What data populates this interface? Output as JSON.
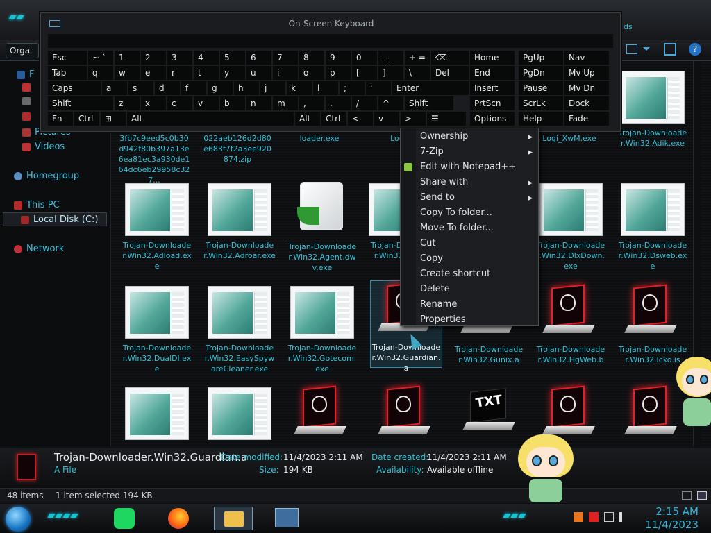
{
  "toolbar": {
    "organize": "Orga",
    "nav_fragment": "ds"
  },
  "keyboard": {
    "title": "On-Screen Keyboard",
    "row1": [
      "Esc",
      "~ `",
      "1",
      "2",
      "3",
      "4",
      "5",
      "6",
      "7",
      "8",
      "9",
      "0",
      "- _",
      "+ =",
      "⌫"
    ],
    "row1_sub": [
      "",
      "",
      "!",
      "@",
      "#",
      "$",
      "%",
      "^",
      "&",
      "*",
      "(",
      ")",
      "",
      ""
    ],
    "row2": [
      "Tab",
      "q",
      "w",
      "e",
      "r",
      "t",
      "y",
      "u",
      "i",
      "o",
      "p",
      "[",
      "]",
      "\\",
      "Del"
    ],
    "row3": [
      "Caps",
      "a",
      "s",
      "d",
      "f",
      "g",
      "h",
      "j",
      "k",
      "l",
      ";",
      "'",
      "Enter"
    ],
    "row4": [
      "Shift",
      "z",
      "x",
      "c",
      "v",
      "b",
      "n",
      "m",
      ",",
      ".",
      "/",
      "^",
      "Shift"
    ],
    "row5": [
      "Fn",
      "Ctrl",
      "⊞",
      "Alt",
      "Alt",
      "Ctrl",
      "<",
      "v",
      ">",
      "☰"
    ],
    "nav": [
      [
        "Home",
        "PgUp",
        "Nav"
      ],
      [
        "End",
        "PgDn",
        "Mv Up"
      ],
      [
        "Insert",
        "Pause",
        "Mv Dn"
      ],
      [
        "PrtScn",
        "ScrLk",
        "Dock"
      ],
      [
        "Options",
        "Help",
        "Fade"
      ]
    ]
  },
  "nav": {
    "items": [
      {
        "label": "F",
        "icon": "favorites-star-icon"
      },
      {
        "label": "Pictures",
        "icon": "pictures-icon"
      },
      {
        "label": "Videos",
        "icon": "videos-icon"
      },
      {
        "label": "Homegroup",
        "icon": "homegroup-icon"
      },
      {
        "label": "This PC",
        "icon": "computer-icon"
      },
      {
        "label": "Local Disk (C:)",
        "icon": "drive-icon"
      },
      {
        "label": "Network",
        "icon": "network-icon"
      }
    ]
  },
  "files": [
    {
      "name": "3fb7c9eed5c0b30d942f80b397a13e6ea81ec3a930de164dc6eb29958c327...",
      "kind": "partial"
    },
    {
      "name": "022aeb126d2d80e683f7f2a3ee920874.zip",
      "kind": "partial"
    },
    {
      "name": "loader.exe",
      "kind": "partial"
    },
    {
      "name": "Logi_X",
      "kind": "partial"
    },
    {
      "name": "Logi_XwM.exe",
      "kind": "partial"
    },
    {
      "name": "Trojan-Downloader.Win32.Adik.exe",
      "kind": "doc"
    },
    {
      "name": "Trojan-Downloader.Win32.Adload.exe",
      "kind": "doc"
    },
    {
      "name": "Trojan-Downloader.Win32.Adroar.exe",
      "kind": "doc"
    },
    {
      "name": "Trojan-Downloader.Win32.Agent.dwv.exe",
      "kind": "cube"
    },
    {
      "name": "Trojan-Downloader.Win32.Agent.h",
      "kind": "doc"
    },
    {
      "name": "Trojan-Downloader.Win32.DlxDown.exe",
      "kind": "doc"
    },
    {
      "name": "Trojan-Downloader.Win32.Dsweb.exe",
      "kind": "doc"
    },
    {
      "name": "Trojan-Downloader.Win32.DualDl.exe",
      "kind": "doc"
    },
    {
      "name": "Trojan-Downloader.Win32.EasySpywareCleaner.exe",
      "kind": "doc"
    },
    {
      "name": "Trojan-Downloader.Win32.Gotecom.exe",
      "kind": "doc"
    },
    {
      "name": "Trojan-Downloader.Win32.Guardian.a",
      "kind": "alien"
    },
    {
      "name": "Trojan-Downloader.Win32.Gunix.a",
      "kind": "alien"
    },
    {
      "name": "Trojan-Downloader.Win32.HgWeb.b",
      "kind": "alien"
    },
    {
      "name": "Trojan-Downloader.Win32.Icko.is",
      "kind": "alien"
    }
  ],
  "bottom_row_kinds": [
    "doc",
    "doc",
    "alien",
    "alien",
    "txt",
    "alien",
    "alien"
  ],
  "txt_label": "TXT",
  "context_menu": [
    {
      "label": "Ownership",
      "sub": true
    },
    {
      "label": "7-Zip",
      "sub": true
    },
    {
      "label": "Edit with Notepad++",
      "sub": false
    },
    {
      "label": "Share with",
      "sub": true
    },
    {
      "label": "Send to",
      "sub": true
    },
    {
      "label": "Copy To folder...",
      "sub": false
    },
    {
      "label": "Move To folder...",
      "sub": false
    },
    {
      "label": "Cut",
      "sub": false
    },
    {
      "label": "Copy",
      "sub": false
    },
    {
      "label": "Create shortcut",
      "sub": false
    },
    {
      "label": "Delete",
      "sub": false
    },
    {
      "label": "Rename",
      "sub": false
    },
    {
      "label": "Properties",
      "sub": false
    }
  ],
  "details": {
    "name": "Trojan-Downloader.Win32.Guardian.a",
    "type": "A File",
    "modified_label": "Date modified:",
    "modified": "11/4/2023 2:11 AM",
    "size_label": "Size:",
    "size": "194 KB",
    "created_label": "Date created:",
    "created": "11/4/2023 2:11 AM",
    "availability_label": "Availability:",
    "availability": "Available offline"
  },
  "status": {
    "items": "48 items",
    "selected": "1 item selected  194 KB"
  },
  "taskbar": {
    "time": "2:15 AM",
    "date": "11/4/2023"
  },
  "colors": {
    "accent": "#2ec2d6",
    "alien_red": "#e0202a"
  }
}
